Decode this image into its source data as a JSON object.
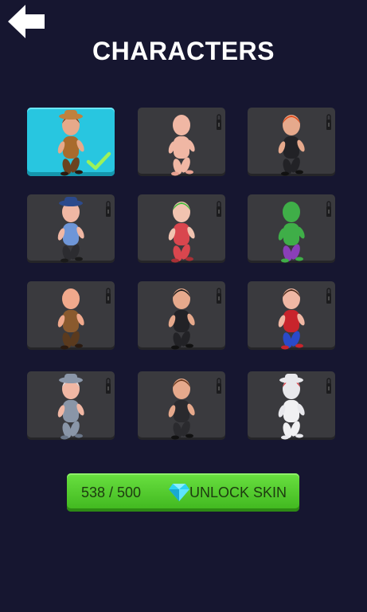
{
  "header": {
    "title": "CHARACTERS",
    "back_icon": "back-arrow-icon"
  },
  "characters": [
    {
      "id": "cowboy",
      "state": "selected",
      "hat": "#c0813d",
      "skin": "#e7a98a",
      "hair": "#6b3a1f",
      "top": "#a86b2d",
      "pants": "#6b4320",
      "shoe": "#2a1a10"
    },
    {
      "id": "baby",
      "state": "locked",
      "hat": null,
      "skin": "#f0b7a4",
      "hair": "#f0b7a4",
      "top": "#f0b7a4",
      "pants": "#f0b7a4",
      "shoe": "#e7a090"
    },
    {
      "id": "redhead",
      "state": "locked",
      "hat": null,
      "skin": "#e6a98c",
      "hair": "#e24b1b",
      "top": "#222226",
      "pants": "#222226",
      "shoe": "#111"
    },
    {
      "id": "officer",
      "state": "locked",
      "hat": "#2c4a8c",
      "skin": "#f0b7a4",
      "hair": "#f0b7a4",
      "top": "#6e96d8",
      "pants": "#2c2c30",
      "shoe": "#1a1a1a"
    },
    {
      "id": "joker",
      "state": "locked",
      "hat": null,
      "skin": "#f1c3b0",
      "hair": "#3fbf3a",
      "top": "#d9464e",
      "pants": "#d9464e",
      "shoe": "#a83036"
    },
    {
      "id": "green-giant",
      "state": "locked",
      "hat": null,
      "skin": "#3fae48",
      "hair": "#3fae48",
      "top": "#3fae48",
      "pants": "#8a3fb8",
      "shoe": "#3fae48"
    },
    {
      "id": "bald-man",
      "state": "locked",
      "hat": null,
      "skin": "#f0a98c",
      "hair": "#f0a98c",
      "top": "#8a5a2e",
      "pants": "#5a3a1e",
      "shoe": "#2a1a10"
    },
    {
      "id": "hitman",
      "state": "locked",
      "hat": null,
      "skin": "#e6a98c",
      "hair": "#1a1a1a",
      "top": "#222226",
      "pants": "#222226",
      "shoe": "#111"
    },
    {
      "id": "heroine",
      "state": "locked",
      "hat": null,
      "skin": "#f0b7a4",
      "hair": "#4a2a1a",
      "top": "#c8242c",
      "pants": "#2a4ac8",
      "shoe": "#c8242c"
    },
    {
      "id": "wizard",
      "state": "locked",
      "hat": "#8a96a8",
      "skin": "#f0b7a4",
      "hair": "#d8dde4",
      "top": "#8a96a8",
      "pants": "#8a96a8",
      "shoe": "#6a7688"
    },
    {
      "id": "agent",
      "state": "locked",
      "hat": null,
      "skin": "#e6a98c",
      "hair": "#6b3a1f",
      "top": "#2a2a2e",
      "pants": "#2a2a2e",
      "shoe": "#111"
    },
    {
      "id": "skeleton",
      "state": "locked",
      "hat": "#e8e8ec",
      "skin": "#e8e8ec",
      "hair": "#e0323a",
      "top": "#f0f0f2",
      "pants": "#f0f0f2",
      "shoe": "#e8e8ec"
    }
  ],
  "icons": {
    "lock": "lock-icon",
    "selected": "checkmark-icon",
    "gem": "diamond-gem-icon"
  },
  "unlock": {
    "cost_text": "538 / 500",
    "label": "UNLOCK SKIN"
  },
  "colors": {
    "background": "#161630",
    "selected_card": "#28c6e0",
    "locked_card": "#3a3a3e",
    "unlock_button": "#4fcc2a",
    "check": "#9df25a"
  }
}
